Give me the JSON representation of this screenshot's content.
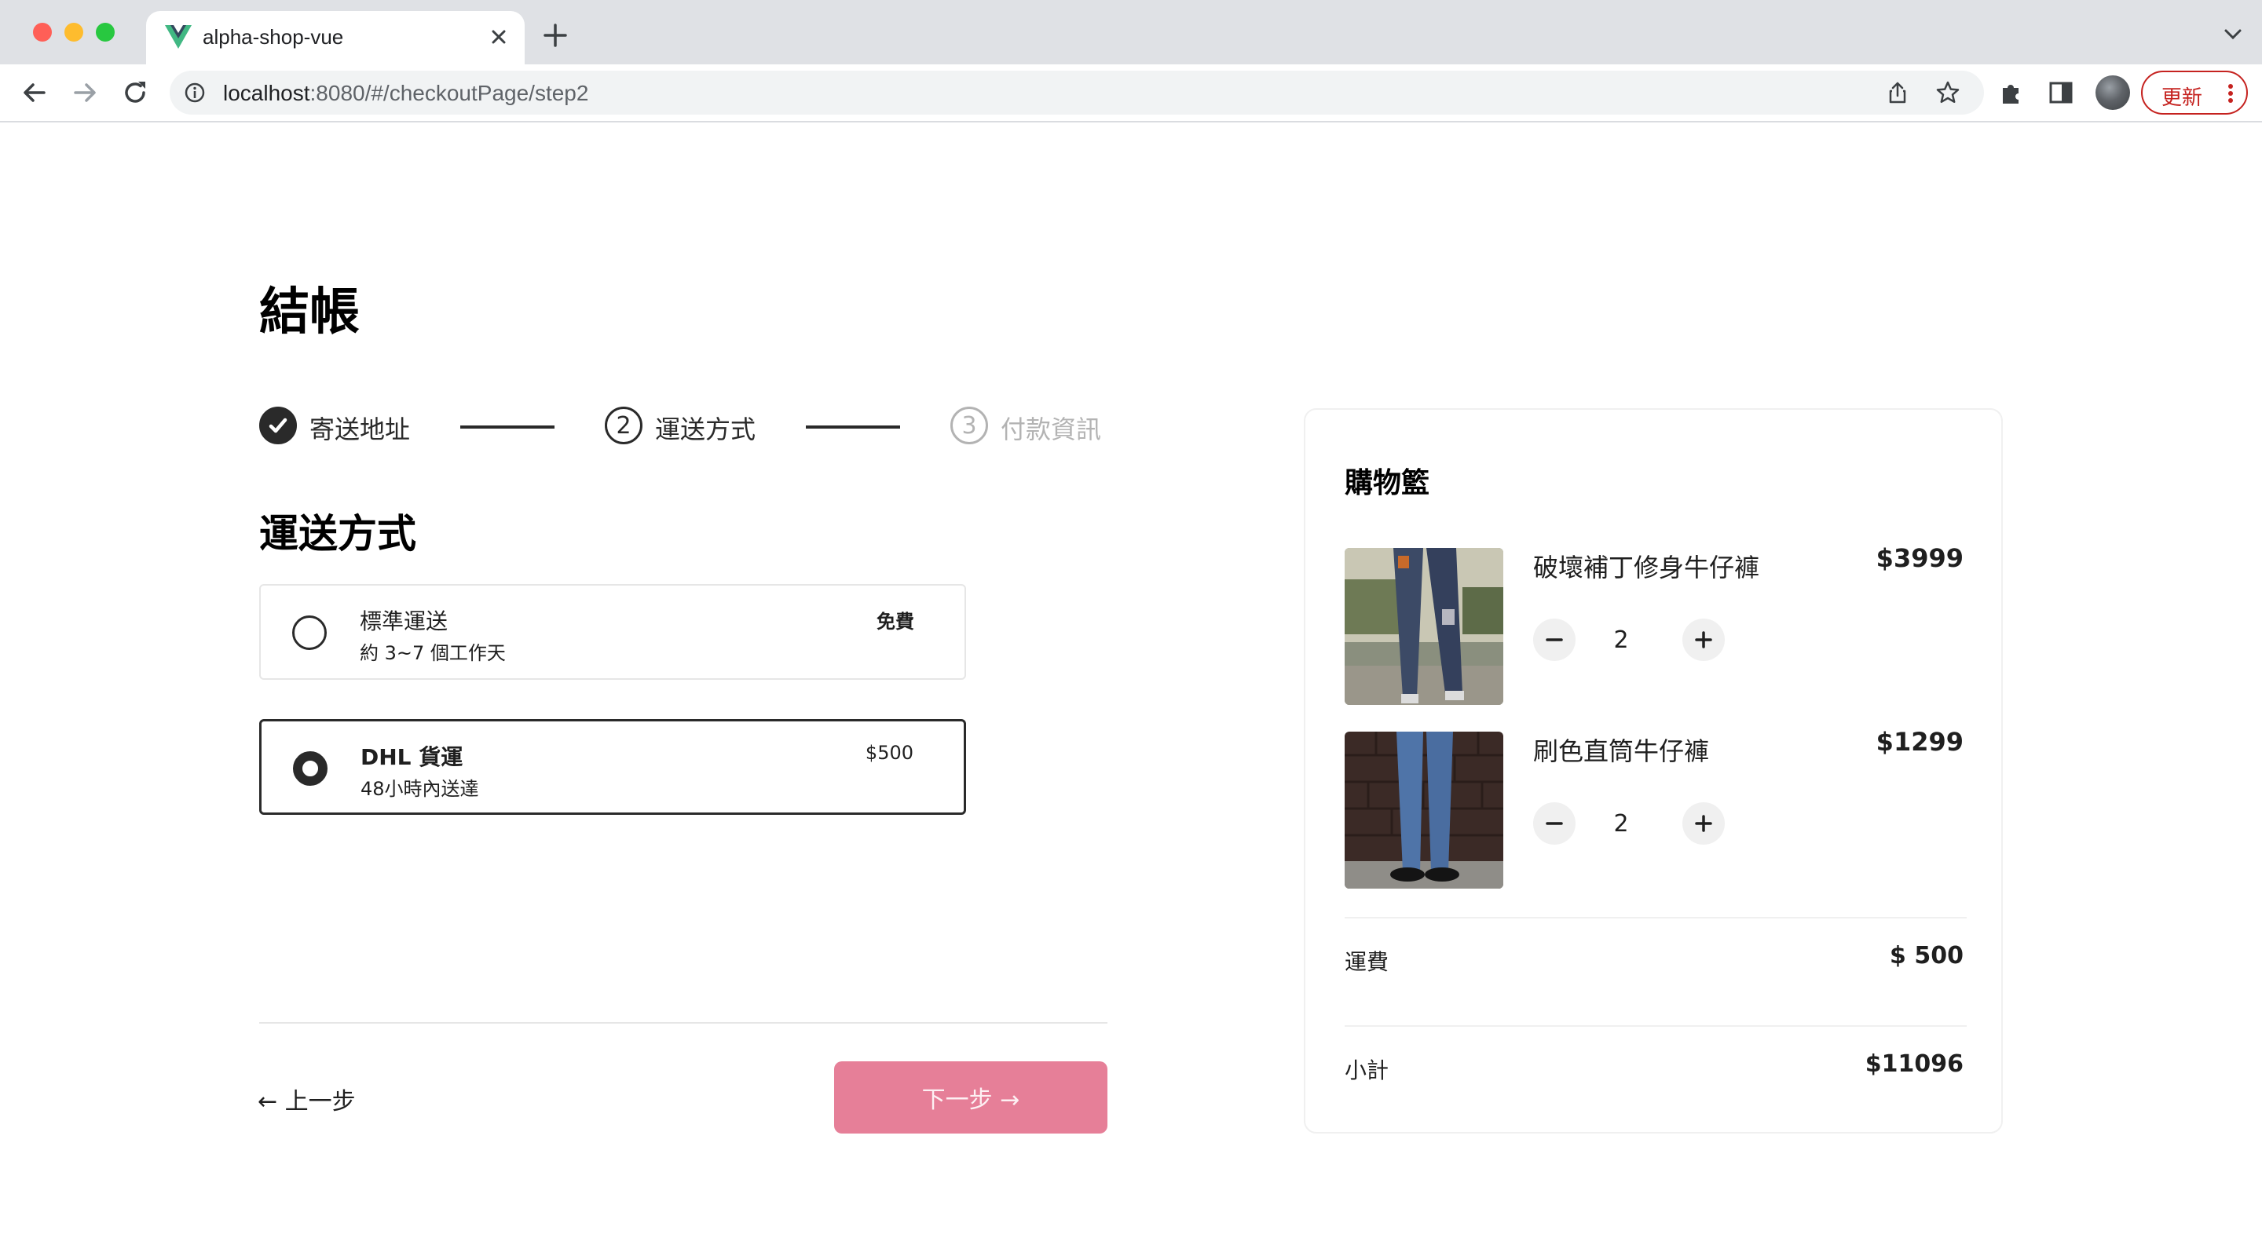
{
  "browser": {
    "tab_title": "alpha-shop-vue",
    "url_host": "localhost",
    "url_rest": ":8080/#/checkoutPage/step2",
    "update_label": "更新"
  },
  "page": {
    "title": "結帳",
    "steps": [
      {
        "number": "1",
        "label": "寄送地址",
        "state": "done"
      },
      {
        "number": "2",
        "label": "運送方式",
        "state": "current"
      },
      {
        "number": "3",
        "label": "付款資訊",
        "state": "todo"
      }
    ],
    "section_title": "運送方式",
    "shipping_options": [
      {
        "name": "標準運送",
        "desc": "約 3~7 個工作天",
        "price": "免費",
        "selected": false
      },
      {
        "name": "DHL 貨運",
        "desc": "48小時內送達",
        "price": "$500",
        "selected": true
      }
    ],
    "prev_label": "← 上一步",
    "next_label": "下一步 →"
  },
  "cart": {
    "title": "購物籃",
    "items": [
      {
        "name": "破壞補丁修身牛仔褲",
        "price": "$3999",
        "qty": "2"
      },
      {
        "name": "刷色直筒牛仔褲",
        "price": "$1299",
        "qty": "2"
      }
    ],
    "shipping_label": "運費",
    "shipping_value": "$ 500",
    "subtotal_label": "小計",
    "subtotal_value": "$11096"
  },
  "colors": {
    "accent": "#e67f98",
    "text": "#2a2a2a",
    "muted": "#b3b3b3",
    "browser_update": "#c5221f"
  }
}
